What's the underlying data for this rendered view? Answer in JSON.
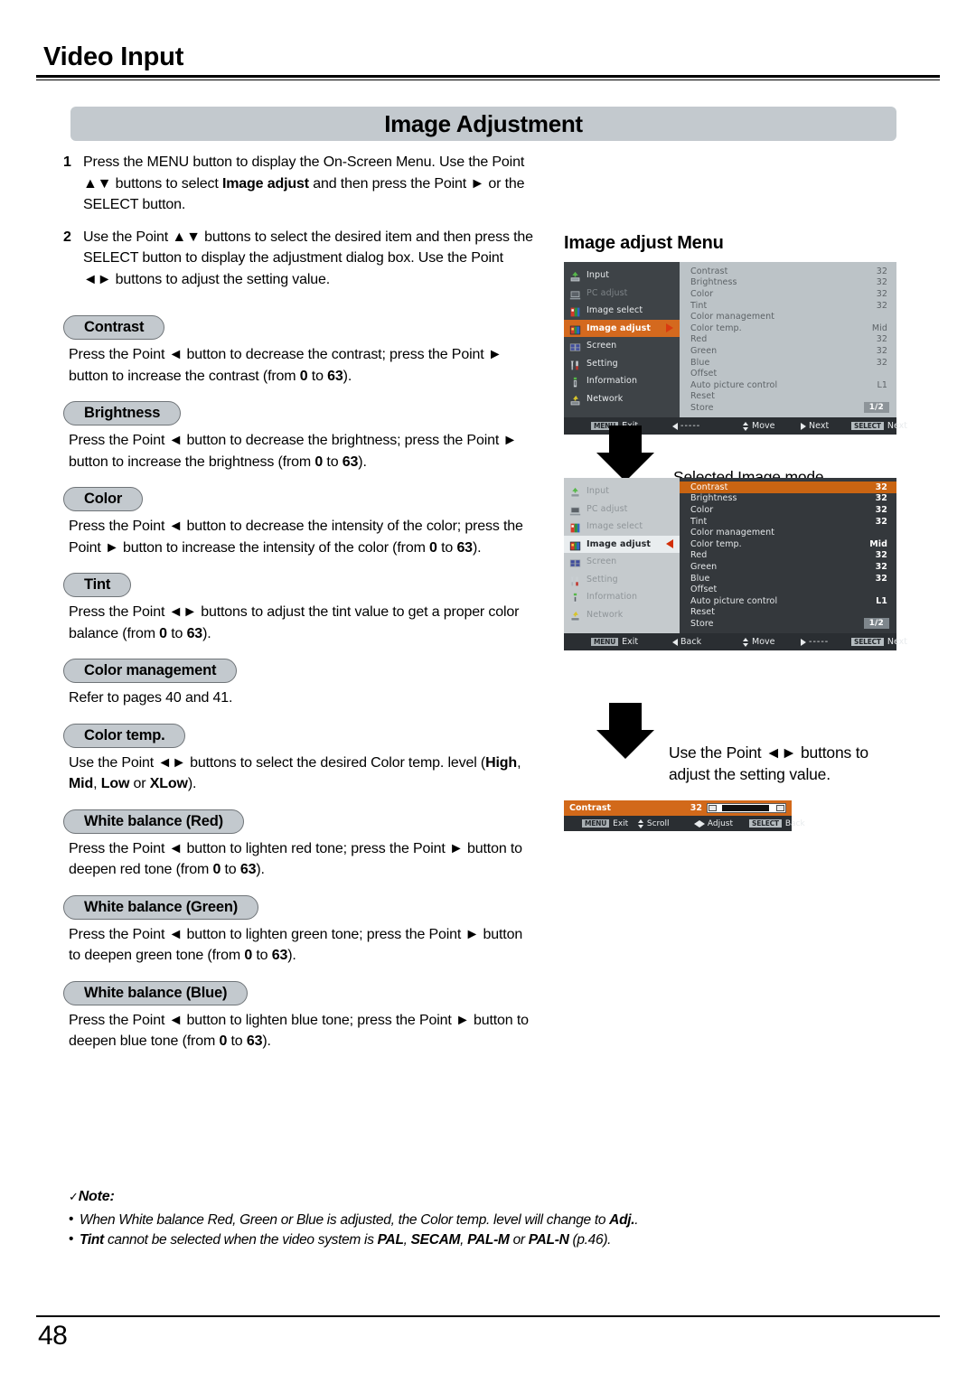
{
  "header": {
    "chapter": "Video Input"
  },
  "banner": {
    "title": "Image Adjustment"
  },
  "steps": [
    {
      "num": "1",
      "parts": [
        {
          "t": "Press the MENU button to display the On-Screen Menu. Use the Point ▲▼ buttons to select ",
          "b": false
        },
        {
          "t": "Image adjust",
          "b": true
        },
        {
          "t": " and then press the Point ► or the SELECT button.",
          "b": false
        }
      ]
    },
    {
      "num": "2",
      "parts": [
        {
          "t": "Use the Point ▲▼ buttons to select the desired item and then press the SELECT button to display the adjustment dialog box. Use the Point ◄► buttons to adjust the setting value.",
          "b": false
        }
      ]
    }
  ],
  "sections": [
    {
      "pill": "Contrast",
      "parts": [
        {
          "t": "Press the Point ◄ button to decrease the contrast; press the Point ► button to increase the contrast (from ",
          "b": false
        },
        {
          "t": "0",
          "b": true
        },
        {
          "t": " to ",
          "b": false
        },
        {
          "t": "63",
          "b": true
        },
        {
          "t": ").",
          "b": false
        }
      ]
    },
    {
      "pill": "Brightness",
      "parts": [
        {
          "t": "Press the Point ◄ button to decrease the brightness; press the Point ► button to increase the brightness (from ",
          "b": false
        },
        {
          "t": "0",
          "b": true
        },
        {
          "t": " to ",
          "b": false
        },
        {
          "t": "63",
          "b": true
        },
        {
          "t": ").",
          "b": false
        }
      ]
    },
    {
      "pill": "Color",
      "parts": [
        {
          "t": "Press the Point ◄ button to decrease the intensity of the color; press the Point ► button to increase the intensity of the color (from ",
          "b": false
        },
        {
          "t": "0",
          "b": true
        },
        {
          "t": " to ",
          "b": false
        },
        {
          "t": "63",
          "b": true
        },
        {
          "t": ").",
          "b": false
        }
      ]
    },
    {
      "pill": "Tint",
      "parts": [
        {
          "t": "Press the Point ◄► buttons to adjust the tint value to get a proper color balance (from ",
          "b": false
        },
        {
          "t": "0",
          "b": true
        },
        {
          "t": " to ",
          "b": false
        },
        {
          "t": "63",
          "b": true
        },
        {
          "t": ").",
          "b": false
        }
      ]
    },
    {
      "pill": "Color management",
      "parts": [
        {
          "t": "Refer to pages 40 and 41.",
          "b": false
        }
      ]
    },
    {
      "pill": "Color temp.",
      "parts": [
        {
          "t": "Use the Point ◄► buttons to select the desired Color temp. level (",
          "b": false
        },
        {
          "t": "High",
          "b": true
        },
        {
          "t": ", ",
          "b": false
        },
        {
          "t": "Mid",
          "b": true
        },
        {
          "t": ", ",
          "b": false
        },
        {
          "t": "Low",
          "b": true
        },
        {
          "t": " or ",
          "b": false
        },
        {
          "t": "XLow",
          "b": true
        },
        {
          "t": ").",
          "b": false
        }
      ]
    },
    {
      "pill": "White balance (Red)",
      "parts": [
        {
          "t": "Press the Point ◄ button to lighten red tone; press the Point ► button to deepen red tone (from ",
          "b": false
        },
        {
          "t": "0",
          "b": true
        },
        {
          "t": " to ",
          "b": false
        },
        {
          "t": "63",
          "b": true
        },
        {
          "t": ").",
          "b": false
        }
      ]
    },
    {
      "pill": "White balance (Green)",
      "parts": [
        {
          "t": "Press the Point ◄ button to lighten green tone; press the Point ► button to deepen green tone (from ",
          "b": false
        },
        {
          "t": "0",
          "b": true
        },
        {
          "t": " to ",
          "b": false
        },
        {
          "t": "63",
          "b": true
        },
        {
          "t": ").",
          "b": false
        }
      ]
    },
    {
      "pill": "White balance (Blue)",
      "parts": [
        {
          "t": "Press the Point ◄ button to lighten blue tone; press the Point ► button to deepen blue tone (from ",
          "b": false
        },
        {
          "t": "0",
          "b": true
        },
        {
          "t": " to ",
          "b": false
        },
        {
          "t": "63",
          "b": true
        },
        {
          "t": ").",
          "b": false
        }
      ]
    }
  ],
  "note": {
    "title": "Note:",
    "check": "✓",
    "items": [
      [
        {
          "t": "When White balance Red, Green or Blue is adjusted, the Color temp. level will change to ",
          "b": false
        },
        {
          "t": "Adj.",
          "b": true
        },
        {
          "t": ".",
          "b": false
        }
      ],
      [
        {
          "t": "Tint",
          "b": true
        },
        {
          "t": " cannot be selected when the video system is ",
          "b": false
        },
        {
          "t": "PAL",
          "b": true
        },
        {
          "t": ", ",
          "b": false
        },
        {
          "t": "SECAM",
          "b": true
        },
        {
          "t": ", ",
          "b": false
        },
        {
          "t": "PAL-M",
          "b": true
        },
        {
          "t": " or ",
          "b": false
        },
        {
          "t": "PAL-N",
          "b": true
        },
        {
          "t": " (p.46).",
          "b": false
        }
      ]
    ]
  },
  "osd": {
    "title": "Image adjust Menu",
    "sidebar": [
      {
        "label": "Input",
        "icon": "input-icon",
        "state": "normal"
      },
      {
        "label": "PC adjust",
        "icon": "pc-adjust-icon",
        "state": "dim"
      },
      {
        "label": "Image select",
        "icon": "image-select-icon",
        "state": "normal"
      },
      {
        "label": "Image adjust",
        "icon": "image-adjust-icon",
        "state": "active"
      },
      {
        "label": "Screen",
        "icon": "screen-icon",
        "state": "normal"
      },
      {
        "label": "Setting",
        "icon": "setting-icon",
        "state": "normal"
      },
      {
        "label": "Information",
        "icon": "information-icon",
        "state": "normal"
      },
      {
        "label": "Network",
        "icon": "network-icon",
        "state": "normal"
      }
    ],
    "items": [
      {
        "label": "Contrast",
        "value": "32"
      },
      {
        "label": "Brightness",
        "value": "32"
      },
      {
        "label": "Color",
        "value": "32"
      },
      {
        "label": "Tint",
        "value": "32"
      },
      {
        "label": "Color management",
        "value": ""
      },
      {
        "label": "Color temp.",
        "value": "Mid"
      },
      {
        "label": "Red",
        "value": "32"
      },
      {
        "label": "Green",
        "value": "32"
      },
      {
        "label": "Blue",
        "value": "32"
      },
      {
        "label": "Offset",
        "value": ""
      },
      {
        "label": "Auto picture control",
        "value": "L1"
      },
      {
        "label": "Reset",
        "value": ""
      },
      {
        "label": "Store",
        "value": ""
      }
    ],
    "page_badge": "1/2",
    "footer_a": {
      "exit_key": "MENU",
      "exit_label": "Exit",
      "back_label": "-----",
      "move_label": "Move",
      "next_label": "Next",
      "select_key": "SELECT",
      "select_label": "Next"
    },
    "footer_b": {
      "exit_key": "MENU",
      "exit_label": "Exit",
      "back_label": "Back",
      "move_label": "Move",
      "next_label": "-----",
      "select_key": "SELECT",
      "select_label": "Next"
    }
  },
  "callouts": {
    "selected_mode": "Selected Image mode",
    "adjust_value_line1": "Use the Point ◄► buttons to",
    "adjust_value_line2": "adjust the setting value."
  },
  "dialog": {
    "label": "Contrast",
    "value": "32",
    "exit_key": "MENU",
    "exit_label": "Exit",
    "scroll_label": "Scroll",
    "adjust_label": "Adjust",
    "select_key": "SELECT",
    "back_label": "Back"
  },
  "footer": {
    "page_number": "48"
  },
  "colors": {
    "banner_gray": "#c3c9ce",
    "accent_orange": "#d2691a",
    "osd_dark": "#34383c",
    "osd_light": "#bcc3c7"
  }
}
